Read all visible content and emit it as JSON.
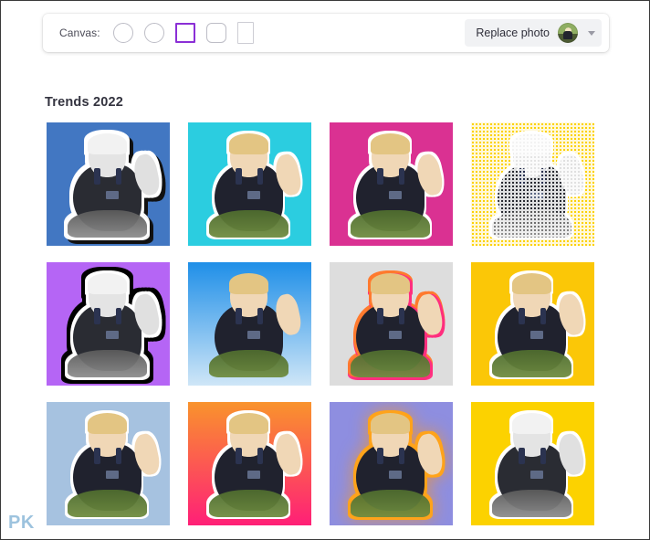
{
  "toolbar": {
    "canvas_label": "Canvas:",
    "shapes": [
      {
        "name": "circle-small",
        "icon": "circle-outline",
        "selected": false
      },
      {
        "name": "circle-large",
        "icon": "circle-outline",
        "selected": false
      },
      {
        "name": "square",
        "icon": "square-outline",
        "selected": true
      },
      {
        "name": "rounded-square",
        "icon": "rounded-square-outline",
        "selected": false
      },
      {
        "name": "portrait",
        "icon": "portrait-rect-outline",
        "selected": false
      }
    ],
    "selected_shape": "square",
    "selected_shape_color": "#8b2fd6",
    "replace_photo_label": "Replace photo",
    "thumbnail_icon": "photo-thumbnail",
    "dropdown_icon": "caret-down-icon"
  },
  "page_title": "Trends 2022",
  "watermark": "PK",
  "gallery": {
    "columns": 4,
    "rows": 3,
    "tiles": [
      {
        "id": 1,
        "background": "#4277c2",
        "bg_type": "solid",
        "outline": "white-black-shadow",
        "photo": "grayscale",
        "label": "trend-style-1"
      },
      {
        "id": 2,
        "background": "#2bcde0",
        "bg_type": "solid",
        "outline": "white",
        "photo": "color",
        "label": "trend-style-2"
      },
      {
        "id": 3,
        "background": "#da3192",
        "bg_type": "solid",
        "outline": "white",
        "photo": "color",
        "label": "trend-style-3"
      },
      {
        "id": 4,
        "background": "#fcd200",
        "bg_type": "solid",
        "outline": "white",
        "photo": "halftone",
        "label": "trend-style-4"
      },
      {
        "id": 5,
        "background": "#b565f5",
        "bg_type": "solid",
        "outline": "white-black-double",
        "photo": "grayscale",
        "label": "trend-style-5"
      },
      {
        "id": 6,
        "background": "linear-gradient(#1f8fe8, #cfe6f7)",
        "bg_type": "gradient",
        "outline": "none",
        "photo": "color",
        "label": "trend-style-6"
      },
      {
        "id": 7,
        "background": "#dddddd",
        "bg_type": "solid",
        "outline": "orange-pink",
        "photo": "color",
        "label": "trend-style-7"
      },
      {
        "id": 8,
        "background": "#fbc707",
        "bg_type": "solid",
        "outline": "white",
        "photo": "color",
        "label": "trend-style-8"
      },
      {
        "id": 9,
        "background": "#a6c2e0",
        "bg_type": "solid",
        "outline": "white",
        "photo": "color",
        "label": "trend-style-9"
      },
      {
        "id": 10,
        "background": "linear-gradient(#f9932c, #ff1f77)",
        "bg_type": "gradient",
        "outline": "white",
        "photo": "color",
        "label": "trend-style-10"
      },
      {
        "id": 11,
        "background": "#8e8ee0",
        "bg_type": "solid",
        "outline": "orange-glow",
        "photo": "color",
        "label": "trend-style-11"
      },
      {
        "id": 12,
        "background": "#fcd200",
        "bg_type": "solid",
        "outline": "white",
        "photo": "grayscale",
        "label": "trend-style-12"
      }
    ]
  }
}
